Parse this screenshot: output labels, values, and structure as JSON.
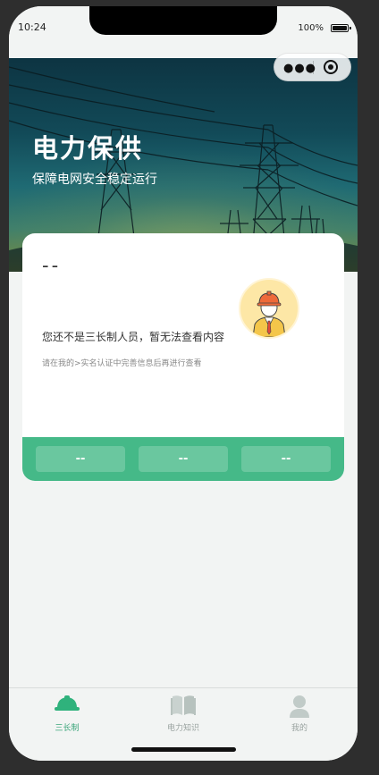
{
  "status_bar": {
    "time": "10:24",
    "battery": "100%"
  },
  "hero": {
    "title": "电力保供",
    "subtitle": "保障电网安全稳定运行"
  },
  "user_card": {
    "name": "--",
    "message": "您还不是三长制人员，暂无法查看内容",
    "hint": "请在我的>实名认证中完善信息后再进行查看",
    "stats": [
      "--",
      "--",
      "--"
    ]
  },
  "tabbar": {
    "items": [
      {
        "label": "三长制",
        "icon": "hard-hat-icon",
        "active": true
      },
      {
        "label": "电力知识",
        "icon": "book-icon",
        "active": false
      },
      {
        "label": "我的",
        "icon": "user-icon",
        "active": false
      }
    ]
  },
  "colors": {
    "accent": "#45b988",
    "tab_active": "#3aa57a",
    "tab_inactive": "#9aa3a0"
  }
}
